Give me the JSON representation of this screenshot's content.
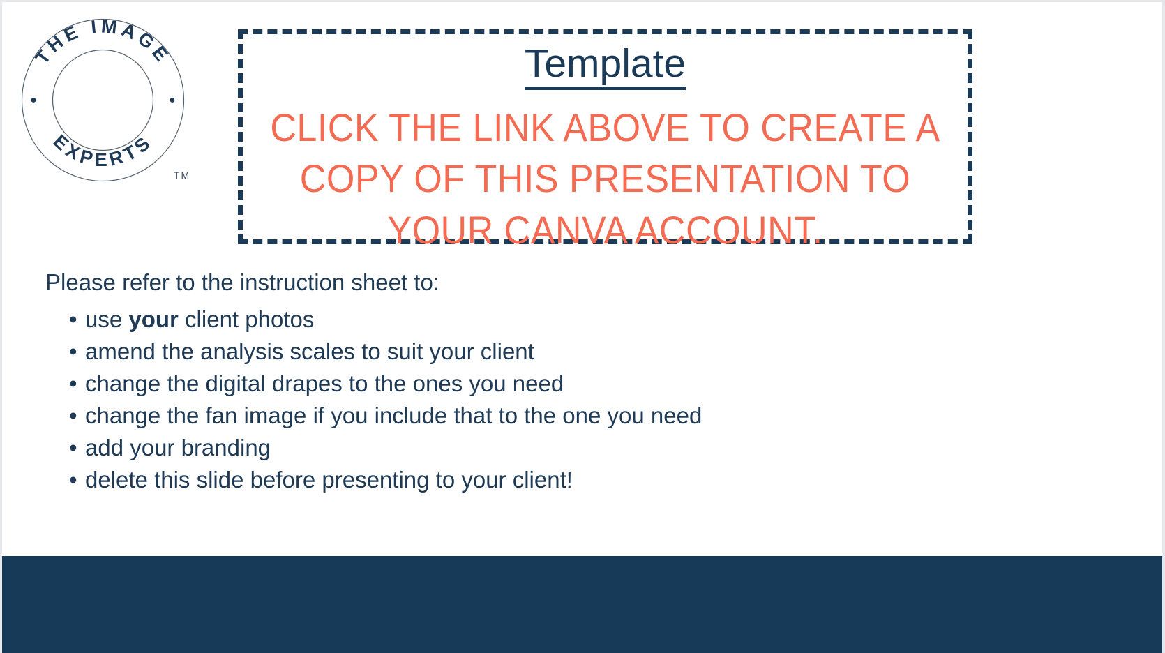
{
  "slide": {
    "background_color": "#ffffff",
    "page_background_color": "#e6e8ec"
  },
  "logo": {
    "name": "the-image-experts-logo",
    "top_arc_text": "THE IMAGE",
    "bottom_arc_text": "EXPERTS",
    "trademark": "TM",
    "color": "#1f3a57"
  },
  "callout": {
    "link_label": "Template",
    "message": "CLICK THE LINK ABOVE TO CREATE A COPY OF THIS PRESENTATION TO YOUR CANVA ACCOUNT.",
    "border_color": "#1b3a57",
    "link_color": "#1b3a57",
    "message_color": "#f26b52"
  },
  "instructions": {
    "heading": "Please refer to the instruction sheet to:",
    "bullet_glyph": "•",
    "items": [
      {
        "prefix": "use ",
        "emphasis": "your",
        "suffix": " client photos"
      },
      {
        "prefix": "amend the analysis scales to suit your client",
        "emphasis": "",
        "suffix": ""
      },
      {
        "prefix": "change the digital drapes to the ones you need",
        "emphasis": "",
        "suffix": ""
      },
      {
        "prefix": "change the fan image if you include that to the one you need",
        "emphasis": "",
        "suffix": ""
      },
      {
        "prefix": "add your branding",
        "emphasis": "",
        "suffix": ""
      },
      {
        "prefix": "delete this slide before presenting to your client!",
        "emphasis": "",
        "suffix": ""
      }
    ],
    "text_color": "#1e3a55"
  },
  "footer_band": {
    "color": "#183a59"
  }
}
